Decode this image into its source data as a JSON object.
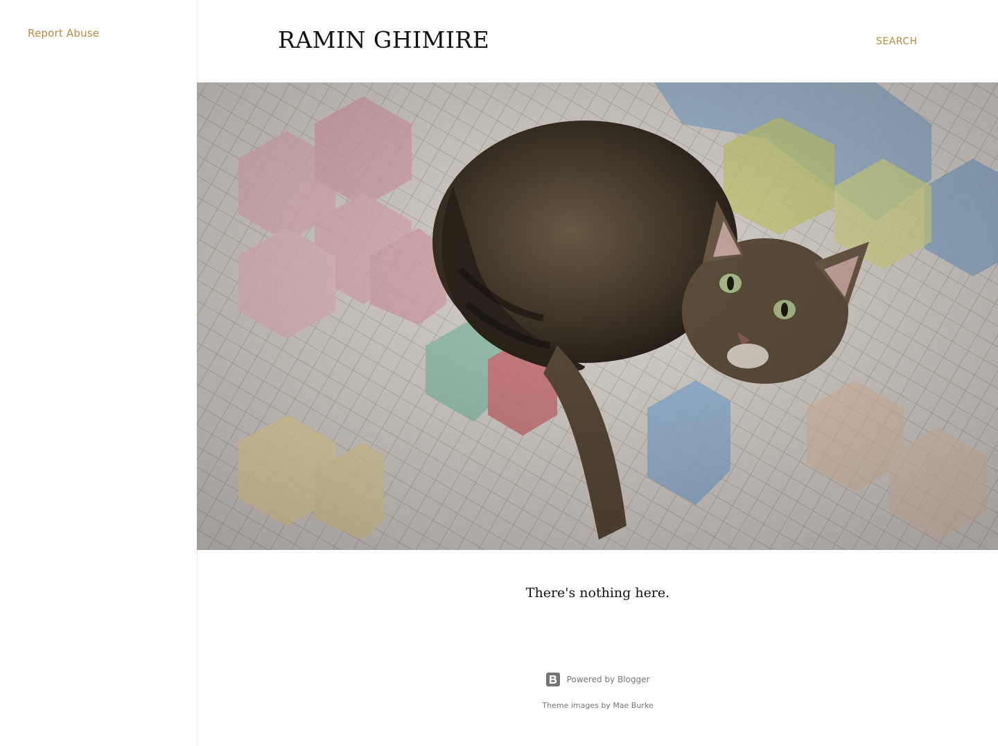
{
  "sidebar": {
    "report_abuse_label": "Report Abuse"
  },
  "header": {
    "blog_title": "RAMIN GHIMIRE",
    "search_label": "SEARCH"
  },
  "hero": {
    "image_subject": "tabby cat lying on quilt"
  },
  "main": {
    "empty_message": "There's nothing here."
  },
  "footer": {
    "powered_by_label": "Powered by Blogger",
    "blogger_icon": "blogger-icon",
    "theme_images_prefix": "Theme images by ",
    "theme_images_author": "Mae Burke"
  },
  "colors": {
    "accent": "#b9893c",
    "muted_text": "#757575",
    "title_text": "#111111"
  }
}
